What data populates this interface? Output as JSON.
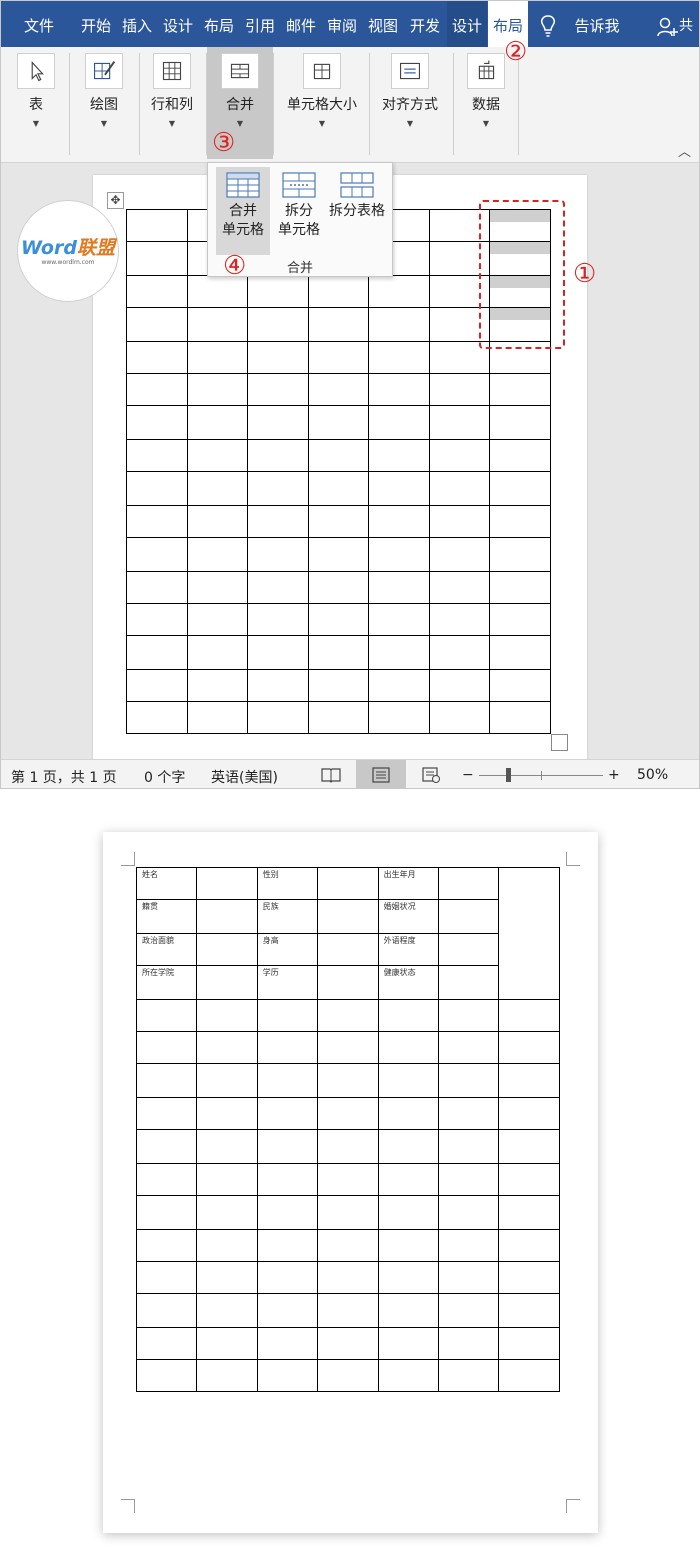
{
  "menu": {
    "tabs": [
      "文件",
      "开始",
      "插入",
      "设计",
      "布局",
      "引用",
      "邮件",
      "审阅",
      "视图",
      "开发",
      "设计",
      "布局"
    ],
    "active_tab": "布局",
    "tell_me": "告诉我",
    "more": "共"
  },
  "ribbon": {
    "groups": [
      "表",
      "绘图",
      "行和列",
      "合并",
      "单元格大小",
      "对齐方式",
      "数据"
    ]
  },
  "merge_dropdown": {
    "merge_line1": "合并",
    "merge_line2": "单元格",
    "split_line1": "拆分",
    "split_line2": "单元格",
    "split_table": "拆分表格",
    "group_label": "合并"
  },
  "logo": {
    "brand_word": "Word",
    "brand_cn": "联盟",
    "site": "www.wordlm.com"
  },
  "markers": {
    "m1": "①",
    "m2": "②",
    "m3": "③",
    "m4": "④"
  },
  "statusbar": {
    "page": "第 1 页，共 1 页",
    "words": "0 个字",
    "language": "英语(美国)",
    "zoom_minus": "−",
    "zoom_plus": "+",
    "zoom": "50%",
    "zoom_level_percent": 50
  },
  "form_table": {
    "rows": [
      [
        "姓名",
        "",
        "性别",
        "",
        "出生年月",
        ""
      ],
      [
        "籍贯",
        "",
        "民族",
        "",
        "婚姻状况",
        ""
      ],
      [
        "政治面貌",
        "",
        "身高",
        "",
        "外语程度",
        ""
      ],
      [
        "所在学院",
        "",
        "学历",
        "",
        "健康状态",
        ""
      ]
    ]
  },
  "colors": {
    "ribbon_blue": "#2b579a",
    "marker_red": "#d22222",
    "selection_gray": "#cfcfcf"
  }
}
